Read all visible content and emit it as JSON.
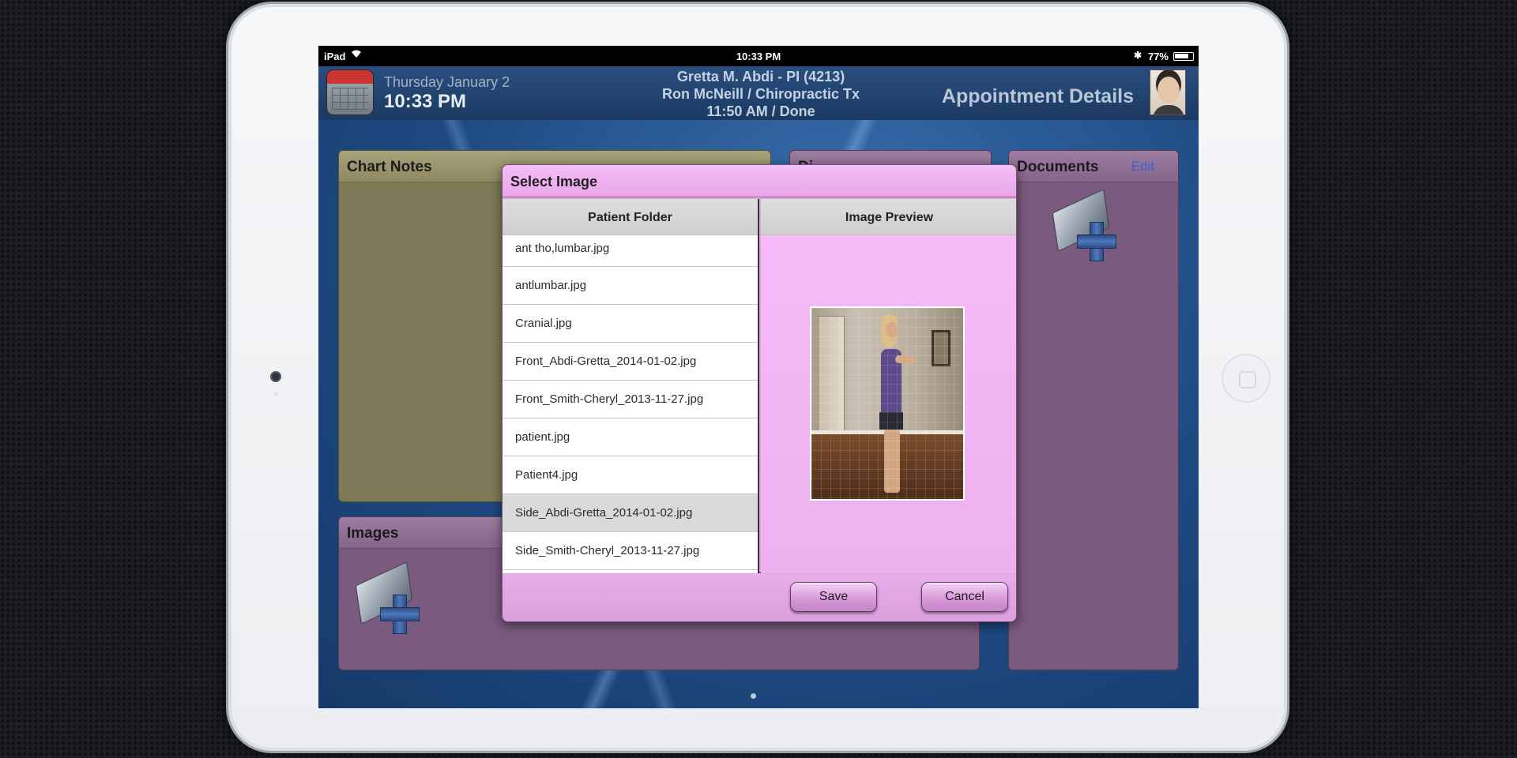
{
  "status_bar": {
    "carrier": "iPad",
    "time": "10:33 PM",
    "battery_text": "77%",
    "battery_level": 0.77
  },
  "header": {
    "date": "Thursday January 2",
    "time": "10:33 PM",
    "patient_line": "Gretta M. Abdi - PI (4213)",
    "provider_line": "Ron McNeill / Chiropractic Tx",
    "status_line": "11:50 AM / Done",
    "page_title": "Appointment Details"
  },
  "panels": {
    "chart_notes": {
      "title": "Chart Notes"
    },
    "images": {
      "title": "Images"
    },
    "middle": {
      "title": "Di"
    },
    "documents": {
      "title": "Documents",
      "edit_label": "Edit"
    }
  },
  "dialog": {
    "title": "Select Image",
    "left_column_header": "Patient Folder",
    "right_column_header": "Image Preview",
    "files": [
      {
        "name": "ant tho,lumbar.jpg",
        "selected": false
      },
      {
        "name": "antlumbar.jpg",
        "selected": false
      },
      {
        "name": "Cranial.jpg",
        "selected": false
      },
      {
        "name": "Front_Abdi-Gretta_2014-01-02.jpg",
        "selected": false
      },
      {
        "name": "Front_Smith-Cheryl_2013-11-27.jpg",
        "selected": false
      },
      {
        "name": "patient.jpg",
        "selected": false
      },
      {
        "name": "Patient4.jpg",
        "selected": false
      },
      {
        "name": "Side_Abdi-Gretta_2014-01-02.jpg",
        "selected": true
      },
      {
        "name": "Side_Smith-Cheryl_2013-11-27.jpg",
        "selected": false
      }
    ],
    "save_label": "Save",
    "cancel_label": "Cancel"
  },
  "colors": {
    "dialog_accent": "#e9a6ea",
    "panel_purple": "#7b5a7f",
    "panel_olive": "#7e7a58",
    "link_blue": "#3d5fd0"
  }
}
